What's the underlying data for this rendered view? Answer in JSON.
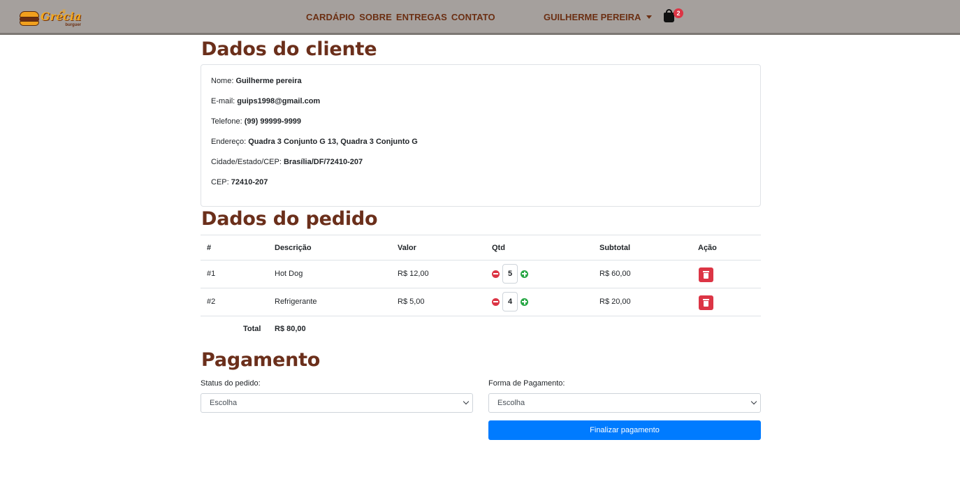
{
  "brand": {
    "name": "Grécia",
    "sub": "burguer"
  },
  "nav": {
    "links": [
      "CARDÁPIO",
      "SOBRE",
      "ENTREGAS",
      "CONTATO"
    ],
    "user": "GUILHERME PEREIRA",
    "cart_count": "2"
  },
  "client": {
    "title": "Dados do cliente",
    "fields": [
      {
        "label": "Nome: ",
        "value": "Guilherme pereira"
      },
      {
        "label": "E-mail: ",
        "value": "guips1998@gmail.com"
      },
      {
        "label": "Telefone: ",
        "value": "(99) 99999-9999"
      },
      {
        "label": "Endereço: ",
        "value": "Quadra 3 Conjunto G 13, Quadra 3 Conjunto G"
      },
      {
        "label": "Cidade/Estado/CEP: ",
        "value": "Brasília/DF/72410-207"
      },
      {
        "label": "CEP: ",
        "value": "72410-207"
      }
    ]
  },
  "order": {
    "title": "Dados do pedido",
    "headers": [
      "#",
      "Descrição",
      "Valor",
      "Qtd",
      "Subtotal",
      "Ação"
    ],
    "rows": [
      {
        "id": "#1",
        "desc": "Hot Dog",
        "price": "R$ 12,00",
        "qty": "5",
        "subtotal": "R$ 60,00"
      },
      {
        "id": "#2",
        "desc": "Refrigerante",
        "price": "R$ 5,00",
        "qty": "4",
        "subtotal": "R$ 20,00"
      }
    ],
    "total_label": "Total",
    "total_value": "R$ 80,00"
  },
  "payment": {
    "title": "Pagamento",
    "status_label": "Status do pedido:",
    "status_value": "Escolha",
    "method_label": "Forma de Pagamento:",
    "method_value": "Escolha",
    "submit": "Finalizar pagamento"
  },
  "colors": {
    "heading": "#6b2f1b",
    "navbar": "#a5a09d",
    "primary": "#007bff",
    "danger": "#dc3545",
    "success": "#28a745"
  }
}
